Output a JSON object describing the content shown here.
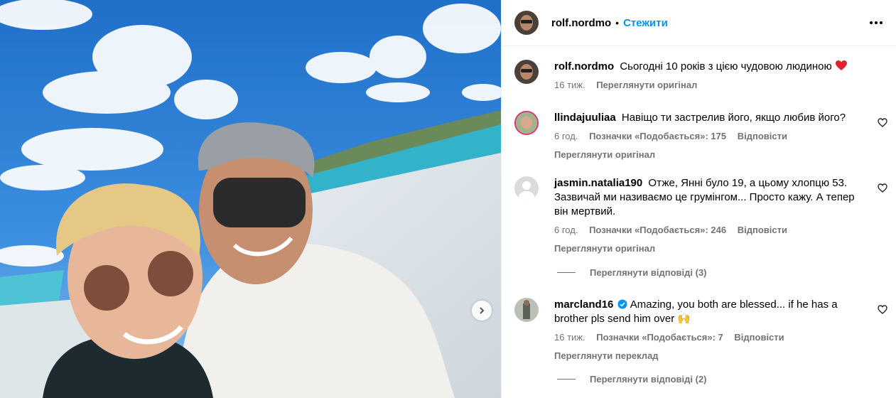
{
  "post": {
    "username": "rolf.nordmo",
    "follow_label": "Стежити",
    "dot": "•"
  },
  "caption": {
    "username": "rolf.nordmo",
    "text": "Сьогодні 10 років з цією чудовою людиною",
    "time": "16 тиж.",
    "translate": "Переглянути оригінал"
  },
  "comments": [
    {
      "username": "llindajuuliaa",
      "text": "Навіщо ти застрелив його, якщо любив його?",
      "time": "6 год.",
      "likes": "Позначки «Подобається»: 175",
      "reply": "Відповісти",
      "translate": "Переглянути оригінал"
    },
    {
      "username": "jasmin.natalia190",
      "text": "Отже, Янні було 19, а цьому хлопцю 53. Зазвичай ми називаємо це грумінгом... Просто кажу. А тепер він мертвий.",
      "time": "6 год.",
      "likes": "Позначки «Подобається»: 246",
      "reply": "Відповісти",
      "translate": "Переглянути оригінал",
      "view_replies": "Переглянути відповіді (3)"
    },
    {
      "username": "marcland16",
      "text": "Amazing, you both are blessed... if he has a brother pls send him over 🙌",
      "time": "16 тиж.",
      "likes": "Позначки «Подобається»: 7",
      "reply": "Відповісти",
      "translate": "Переглянути переклад",
      "view_replies": "Переглянути відповіді (2)"
    }
  ],
  "colors": {
    "link_blue": "#0095f6",
    "secondary_text": "#737373",
    "heart_red": "#ff3040",
    "verified_blue": "#0095f6"
  },
  "icons": [
    "next-arrow-icon",
    "more-options-icon",
    "heart-emoji-icon",
    "like-heart-icon",
    "verified-badge-icon"
  ]
}
